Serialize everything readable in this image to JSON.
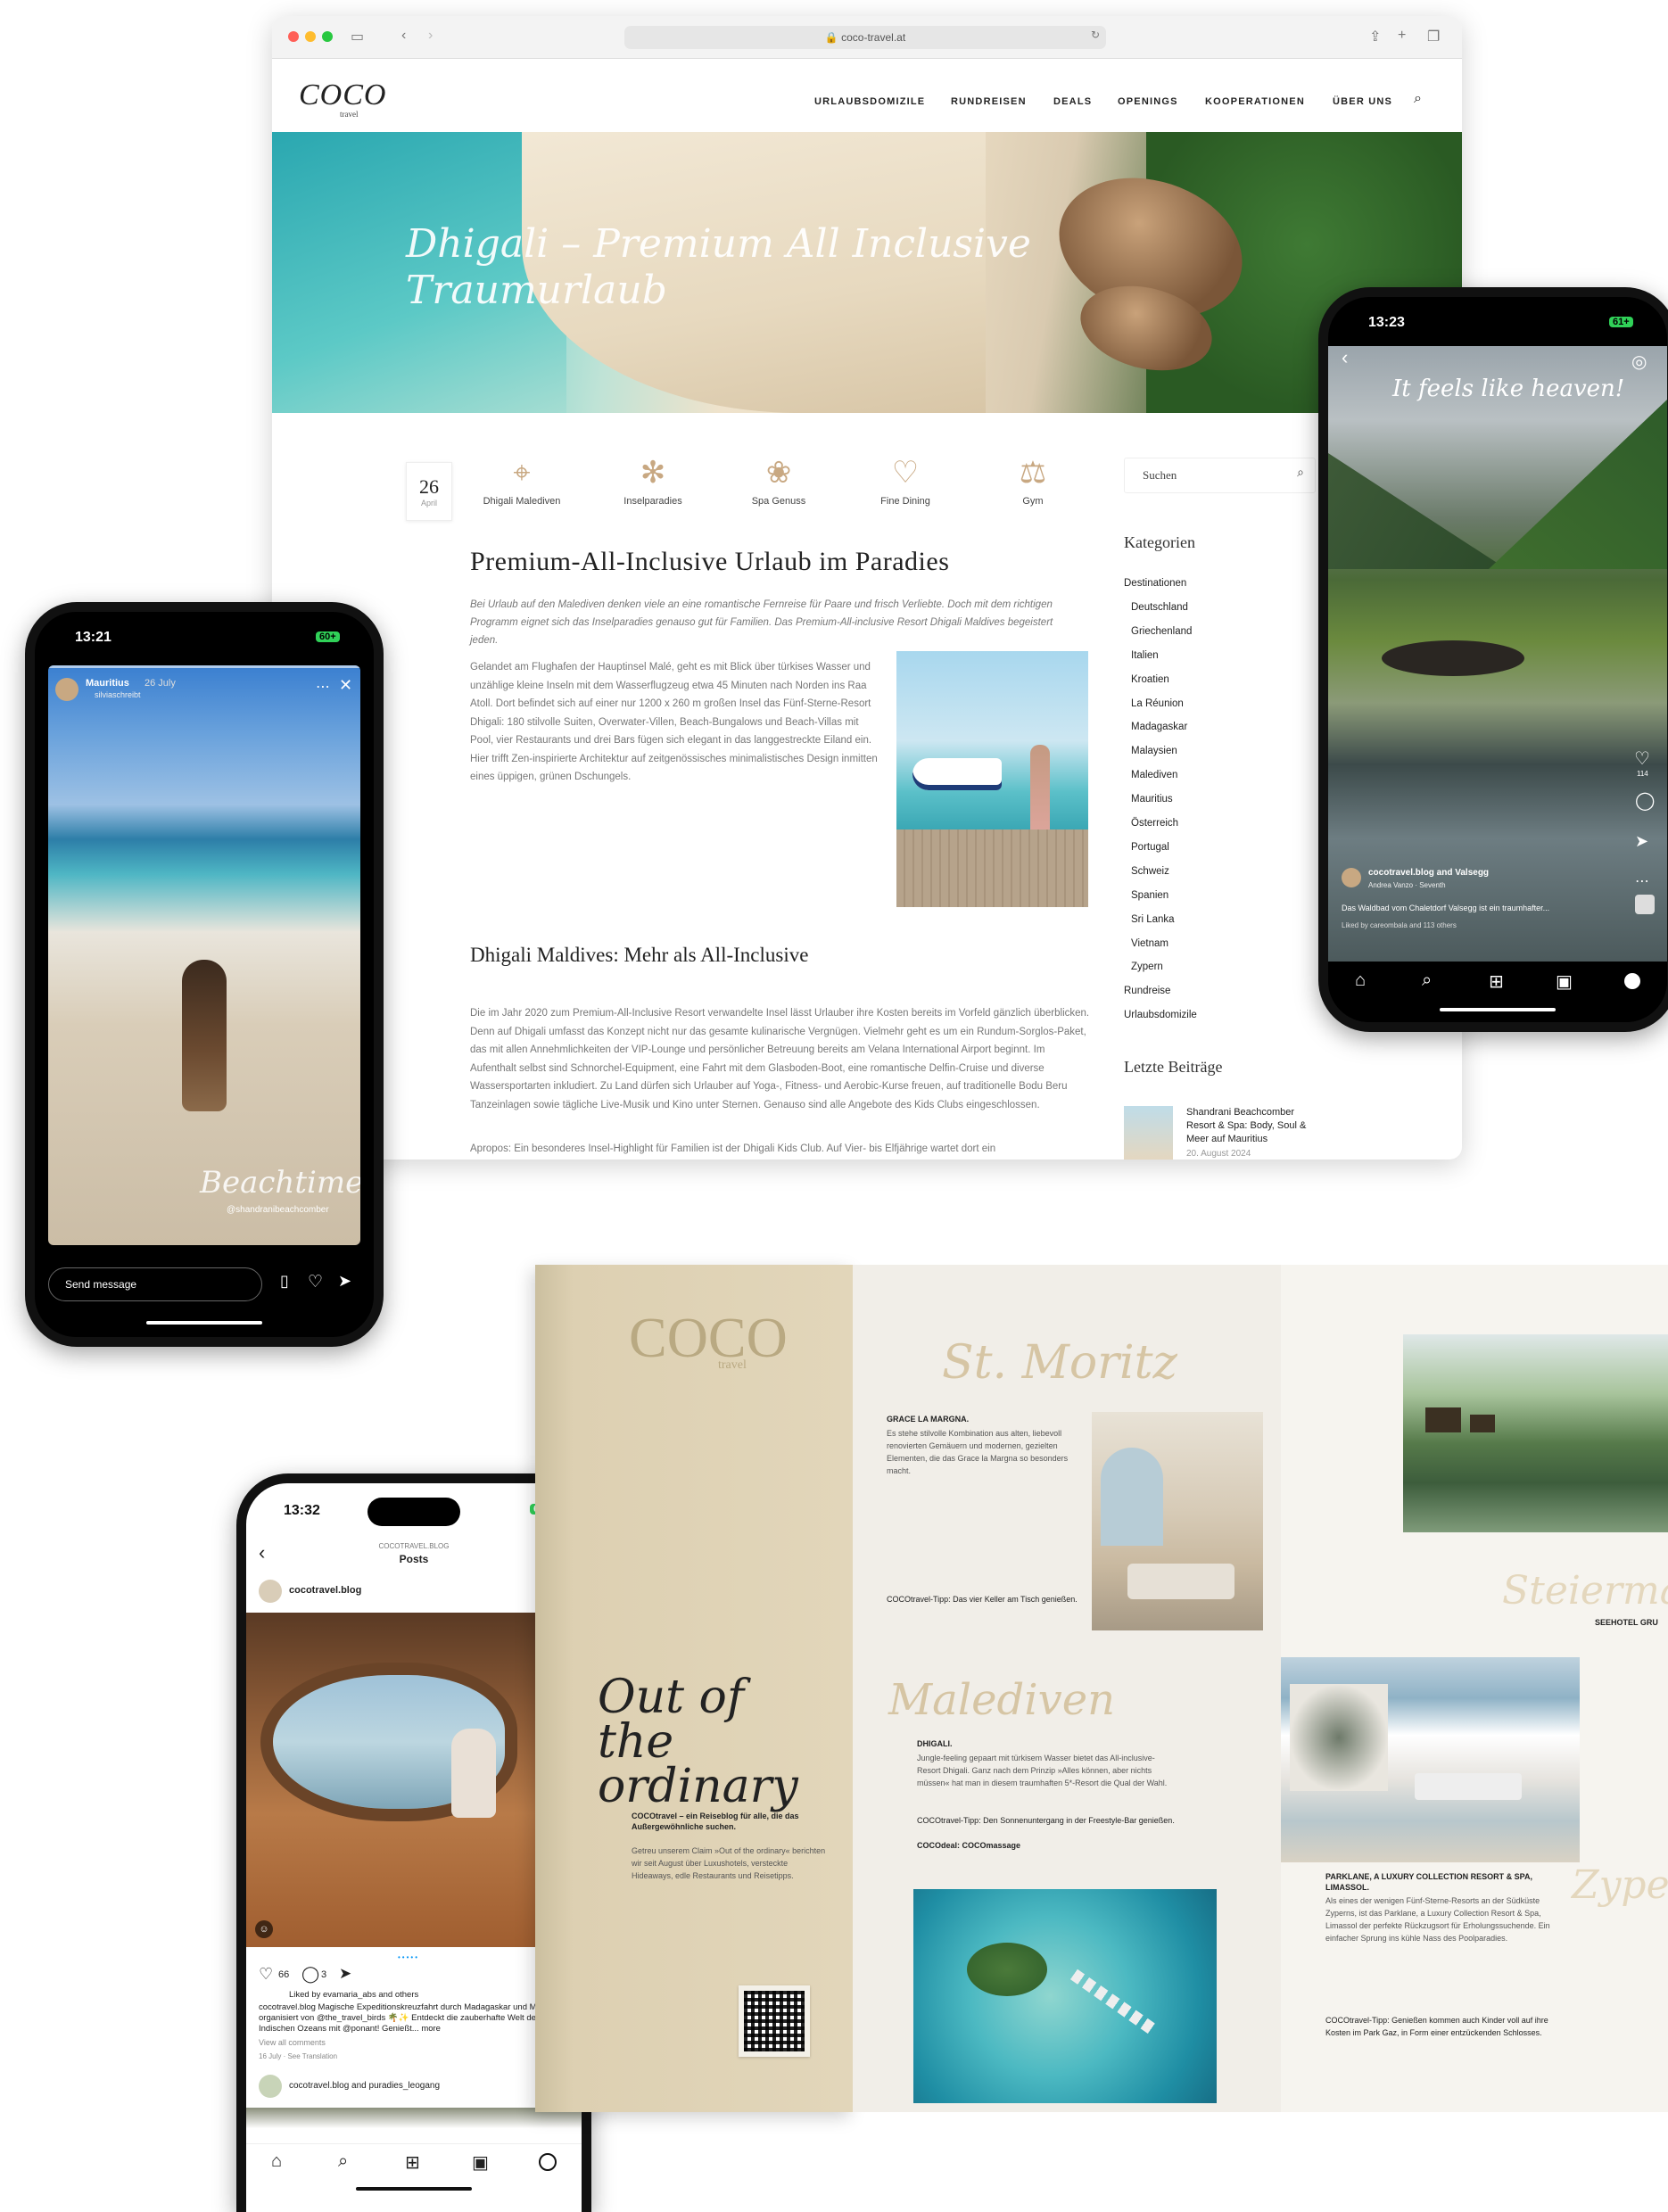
{
  "browser": {
    "url": "coco-travel.at",
    "site": {
      "logo": "COCO",
      "logo_sub": "travel",
      "nav": [
        "URLAUBSDOMIZILE",
        "RUNDREISEN",
        "DEALS",
        "OPENINGS",
        "KOOPERATIONEN",
        "ÜBER UNS"
      ],
      "hero_title": "Dhigali – Premium All Inclusive Traumurlaub",
      "date_day": "26",
      "date_month": "April",
      "features": [
        "Dhigali Malediven",
        "Inselparadies",
        "Spa Genuss",
        "Fine Dining",
        "Gym"
      ],
      "h1": "Premium-All-Inclusive Urlaub im Paradies",
      "intro": "Bei Urlaub auf den Malediven denken viele an eine romantische Fernreise für Paare und frisch Verliebte. Doch mit dem richtigen Programm eignet sich das Inselparadies genauso gut für Familien. Das Premium-All-inclusive Resort Dhigali Maldives begeistert jeden.",
      "body1": "Gelandet am Flughafen der Hauptinsel Malé, geht es mit Blick über türkises Wasser und unzählige kleine Inseln mit dem Wasserflugzeug etwa 45 Minuten nach Norden ins Raa Atoll. Dort befindet sich auf einer nur 1200 x 260 m großen Insel das Fünf-Sterne-Resort Dhigali: 180 stilvolle Suiten, Overwater-Villen, Beach-Bungalows und Beach-Villas mit Pool, vier Restaurants und drei Bars fügen sich elegant in das langgestreckte Eiland ein. Hier trifft Zen-inspirierte Architektur auf zeitgenössisches minimalistisches Design inmitten eines üppigen, grünen Dschungels.",
      "h2": "Dhigali Maldives: Mehr als All-Inclusive",
      "body2": "Die im Jahr 2020 zum Premium-All-Inclusive Resort verwandelte Insel lässt Urlauber ihre Kosten bereits im Vorfeld gänzlich überblicken. Denn auf Dhigali umfasst das Konzept nicht nur das gesamte kulinarische Vergnügen. Vielmehr geht es um ein Rundum-Sorglos-Paket, das mit allen Annehmlichkeiten der VIP-Lounge und persönlicher Betreuung bereits am Velana International Airport beginnt. Im Aufenthalt selbst sind Schnorchel-Equipment, eine Fahrt mit dem Glasboden-Boot, eine romantische Delfin-Cruise und diverse Wassersportarten inkludiert. Zu Land dürfen sich Urlauber auf Yoga-, Fitness- und Aerobic-Kurse freuen, auf traditionelle Bodu Beru Tanzeinlagen sowie tägliche Live-Musik und Kino unter Sternen. Genauso sind alle Angebote des Kids Clubs eingeschlossen.",
      "body3": "Apropos: Ein besonderes Insel-Highlight für Familien ist der Dhigali Kids Club. Auf Vier- bis Elfjährige wartet dort ein",
      "search_placeholder": "Suchen",
      "categories_title": "Kategorien",
      "categories": [
        "Destinationen",
        "Deutschland",
        "Griechenland",
        "Italien",
        "Kroatien",
        "La Réunion",
        "Madagaskar",
        "Malaysien",
        "Malediven",
        "Mauritius",
        "Österreich",
        "Portugal",
        "Schweiz",
        "Spanien",
        "Sri Lanka",
        "Vietnam",
        "Zypern",
        "Rundreise",
        "Urlaubsdomizile"
      ],
      "recent_title": "Letzte Beiträge",
      "recent_post": "Shandrani Beachcomber Resort & Spa: Body, Soul & Meer auf Mauritius",
      "recent_date": "20. August 2024"
    }
  },
  "phone_story": {
    "time": "13:21",
    "battery": "60+",
    "user": "Mauritius",
    "date": "26 July",
    "sub_user": "silviaschreibt",
    "overlay_text": "Beachtime",
    "tag": "@shandranibeachcomber",
    "send_placeholder": "Send message"
  },
  "phone_reel": {
    "time": "13:23",
    "battery": "61+",
    "headline": "It feels like heaven!",
    "account": "cocotravel.blog and Valsegg",
    "audio": "Andrea Vanzo · Seventh",
    "caption": "Das Waldbad vom Chaletdorf Valsegg ist ein traumhafter...",
    "liked": "Liked by careombala and 113 others",
    "likes_count": "114"
  },
  "phone_posts": {
    "time": "13:32",
    "battery": "68",
    "blog_label": "COCOTRAVEL.BLOG",
    "title": "Posts",
    "account": "cocotravel.blog",
    "likes": "66",
    "comments": "3",
    "liked_by": "Liked by evamaria_abs and others",
    "caption": "cocotravel.blog Magische Expeditionskreuzfahrt durch Madagaskar und Mauritius, organisiert von @the_travel_birds 🌴✨ Entdeckt die zauberhafte Welt des Indischen Ozeans mit @ponant! Genießt... more",
    "view_comments": "View all comments",
    "date": "16 July · See Translation",
    "next_account": "cocotravel.blog and puradies_leogang"
  },
  "magazine": {
    "logo": "COCO",
    "logo_sub": "travel",
    "cover_title": "Out of the ordinary",
    "cover_sub": "COCOtravel – ein Reiseblog für alle, die das Außergewöhnliche suchen.",
    "cover_text": "Getreu unserem Claim »Out of the ordinary« berichten wir seit August über Luxushotels, versteckte Hideaways, edle Restaurants und Reisetipps.",
    "stmoritz_title": "St. Moritz",
    "stmoritz_head": "GRACE LA MARGNA.",
    "stmoritz_text": "Es stehe stilvolle Kombination aus alten, liebevoll renovierten Gemäuern und modernen, gezielten Elementen, die das Grace la Margna so besonders macht.",
    "stmoritz_tipp": "COCOtravel-Tipp: Das vier Keller am Tisch genießen.",
    "malediven_title": "Malediven",
    "malediven_head": "DHIGALI.",
    "malediven_text": "Jungle-feeling gepaart mit türkisem Wasser bietet das All-inclusive-Resort Dhigali. Ganz nach dem Prinzip »Alles können, aber nichts müssen« hat man in diesem traumhaften 5*-Resort die Qual der Wahl.",
    "malediven_tipp": "COCOtravel-Tipp: Den Sonnenuntergang in der Freestyle-Bar genießen.",
    "malediven_deal": "COCOdeal: COCOmassage",
    "steiermark_title": "Steiermark",
    "seehotel_head": "SEEHOTEL GRU",
    "zypern_title": "Zypern",
    "parklane_head": "PARKLANE, A LUXURY COLLECTION RESORT & SPA, LIMASSOL.",
    "parklane_text": "Als eines der wenigen Fünf-Sterne-Resorts an der Südküste Zyperns, ist das Parklane, a Luxury Collection Resort & Spa, Limassol der perfekte Rückzugsort für Erholungssuchende. Ein einfacher Sprung ins kühle Nass des Poolparadies.",
    "parklane_tipp": "COCOtravel-Tipp: Genießen kommen auch Kinder voll auf ihre Kosten im Park Gaz, in Form einer entzückenden Schlosses."
  },
  "colors": {
    "gold": "#c8a882",
    "beige": "#ddd0b2",
    "ig_blue": "#0095f6"
  }
}
